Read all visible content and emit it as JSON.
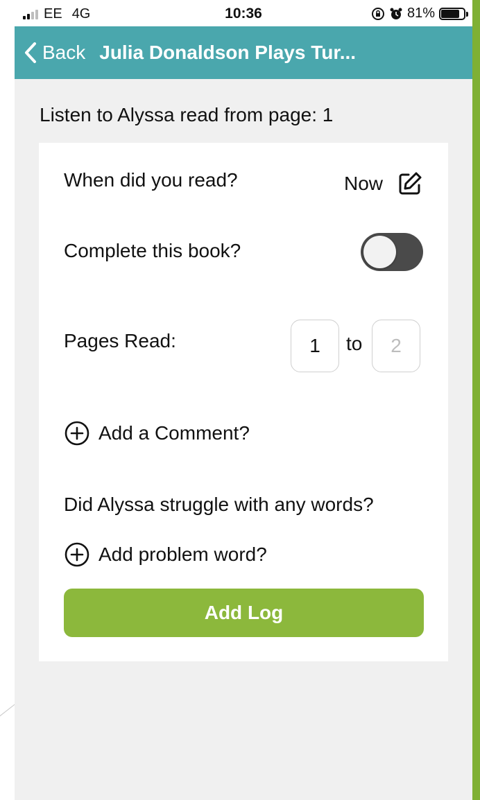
{
  "status_bar": {
    "carrier": "EE",
    "network": "4G",
    "time": "10:36",
    "battery_percent": "81%",
    "battery_level": 0.81
  },
  "nav": {
    "back_label": "Back",
    "title": "Julia Donaldson Plays Tur..."
  },
  "heading": "Listen to Alyssa read from page: 1",
  "form": {
    "when_label": "When did you read?",
    "when_value": "Now",
    "complete_label": "Complete this book?",
    "complete_on": false,
    "pages_label": "Pages Read:",
    "page_from": "1",
    "page_separator": "to",
    "page_to_placeholder": "2",
    "comment_label": "Add a Comment?",
    "struggle_label": "Did Alyssa struggle with any words?",
    "problem_word_label": "Add problem word?",
    "submit_label": "Add Log"
  },
  "colors": {
    "nav_bar": "#4aa7ad",
    "add_log_button": "#8cb83c",
    "toggle_off": "#4a4a4a",
    "screen_background": "#f0f0f0",
    "slide_accent": "#7fb034"
  },
  "icons": [
    "chevron-left-icon",
    "edit-icon",
    "plus-circle-icon",
    "signal-icon",
    "rotation-lock-icon",
    "alarm-icon",
    "battery-icon"
  ]
}
